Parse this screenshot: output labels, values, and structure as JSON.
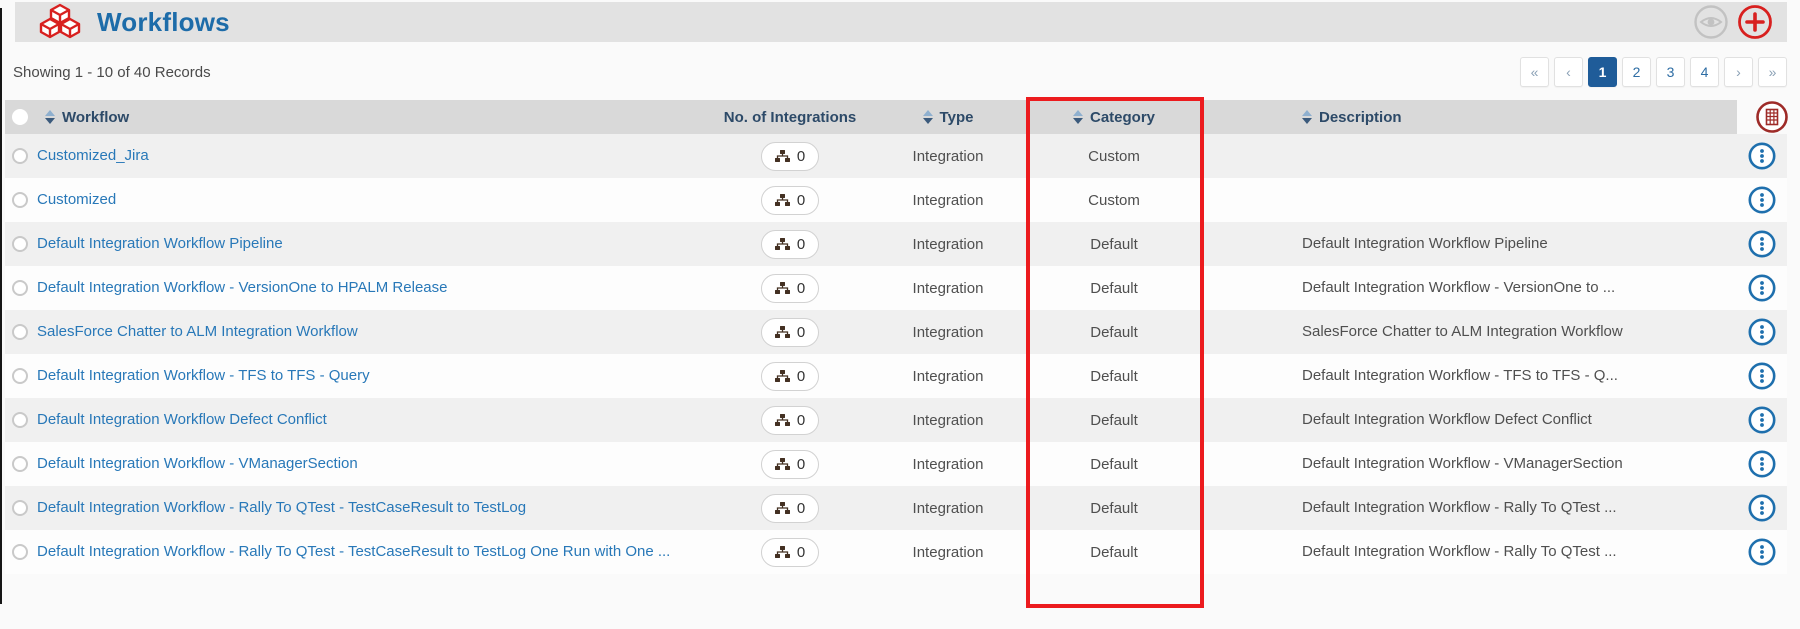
{
  "title_bar": {
    "title": "Workflows",
    "logo_icon": "red-cubes",
    "actions": {
      "preview_icon": "eye",
      "add_icon": "plus-circle"
    }
  },
  "toolbar": {
    "records_summary": "Showing 1 - 10 of 40 Records"
  },
  "pagination": {
    "first": "«",
    "prev": "‹",
    "pages": [
      "1",
      "2",
      "3",
      "4"
    ],
    "next": "›",
    "last": "»",
    "active_page": "1"
  },
  "table": {
    "columns": {
      "workflow": "Workflow",
      "integrations": "No. of Integrations",
      "type": "Type",
      "category": "Category",
      "description": "Description"
    },
    "rows": [
      {
        "workflow": "Customized_Jira",
        "integrations": "0",
        "type": "Integration",
        "category": "Custom",
        "description": ""
      },
      {
        "workflow": "Customized",
        "integrations": "0",
        "type": "Integration",
        "category": "Custom",
        "description": ""
      },
      {
        "workflow": "Default Integration Workflow Pipeline",
        "integrations": "0",
        "type": "Integration",
        "category": "Default",
        "description": "Default Integration Workflow Pipeline"
      },
      {
        "workflow": "Default Integration Workflow - VersionOne to HPALM Release",
        "integrations": "0",
        "type": "Integration",
        "category": "Default",
        "description": "Default Integration Workflow - VersionOne to ..."
      },
      {
        "workflow": "SalesForce Chatter to ALM Integration Workflow",
        "integrations": "0",
        "type": "Integration",
        "category": "Default",
        "description": "SalesForce Chatter to ALM Integration Workflow"
      },
      {
        "workflow": "Default Integration Workflow - TFS to TFS - Query",
        "integrations": "0",
        "type": "Integration",
        "category": "Default",
        "description": "Default Integration Workflow - TFS to TFS - Q..."
      },
      {
        "workflow": "Default Integration Workflow Defect Conflict",
        "integrations": "0",
        "type": "Integration",
        "category": "Default",
        "description": "Default Integration Workflow Defect Conflict"
      },
      {
        "workflow": "Default Integration Workflow - VManagerSection",
        "integrations": "0",
        "type": "Integration",
        "category": "Default",
        "description": "Default Integration Workflow - VManagerSection"
      },
      {
        "workflow": "Default Integration Workflow - Rally To QTest - TestCaseResult to TestLog",
        "integrations": "0",
        "type": "Integration",
        "category": "Default",
        "description": "Default Integration Workflow - Rally To QTest ..."
      },
      {
        "workflow": "Default Integration Workflow - Rally To QTest - TestCaseResult to TestLog One Run with One ...",
        "integrations": "0",
        "type": "Integration",
        "category": "Default",
        "description": "Default Integration Workflow - Rally To QTest ..."
      }
    ]
  },
  "annotation": {
    "type": "highlight-box",
    "target": "Category column",
    "color": "#ec1b1e"
  },
  "colors": {
    "title_blue": "#1d6ca9",
    "link_blue": "#2878b8",
    "brand_red": "#d8201f",
    "active_page_bg": "#1f5c99",
    "header_gray": "#d9d9d9",
    "row_alt_gray": "#f0f0f0"
  }
}
